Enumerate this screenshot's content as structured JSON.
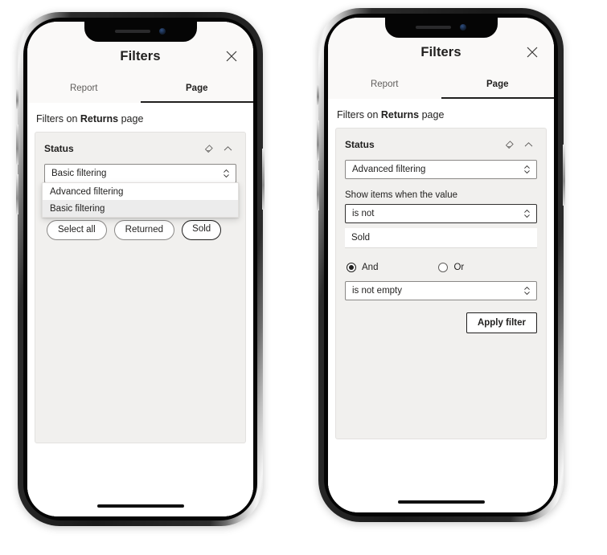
{
  "phones": [
    {
      "id": "basic-filtering",
      "panel": {
        "title": "Filters",
        "close_icon": "close-icon",
        "tabs": [
          {
            "label": "Report",
            "active": false
          },
          {
            "label": "Page",
            "active": true
          }
        ],
        "subtitle_prefix": "Filters on ",
        "subtitle_bold": "Returns",
        "subtitle_suffix": " page"
      },
      "card": {
        "title": "Status",
        "clear_icon": "eraser-icon",
        "collapse_icon": "chevron-up-icon",
        "filter_type": "Basic filtering",
        "dropdown_open": true,
        "dropdown_options": [
          {
            "label": "Advanced filtering",
            "selected": false
          },
          {
            "label": "Basic filtering",
            "selected": true
          }
        ],
        "pills": [
          {
            "label": "Select all",
            "selected": false
          },
          {
            "label": "Returned",
            "selected": false
          },
          {
            "label": "Sold",
            "selected": true
          }
        ]
      }
    },
    {
      "id": "advanced-filtering",
      "panel": {
        "title": "Filters",
        "close_icon": "close-icon",
        "tabs": [
          {
            "label": "Report",
            "active": false
          },
          {
            "label": "Page",
            "active": true
          }
        ],
        "subtitle_prefix": "Filters on ",
        "subtitle_bold": "Returns",
        "subtitle_suffix": " page"
      },
      "card": {
        "title": "Status",
        "clear_icon": "eraser-icon",
        "collapse_icon": "chevron-up-icon",
        "filter_type": "Advanced filtering",
        "show_items_label": "Show items when the value",
        "condition_one": "is not",
        "condition_one_value": "Sold",
        "logic": {
          "and_label": "And",
          "or_label": "Or",
          "selected": "And"
        },
        "condition_two": "is not empty",
        "apply_label": "Apply filter"
      }
    }
  ],
  "colors": {
    "panel_header_bg": "#faf9f8",
    "card_bg": "#f1f0ee",
    "text_primary": "#201f1e",
    "text_secondary": "#605e5c",
    "border": "#8a8886",
    "highlight": "#ececec"
  }
}
